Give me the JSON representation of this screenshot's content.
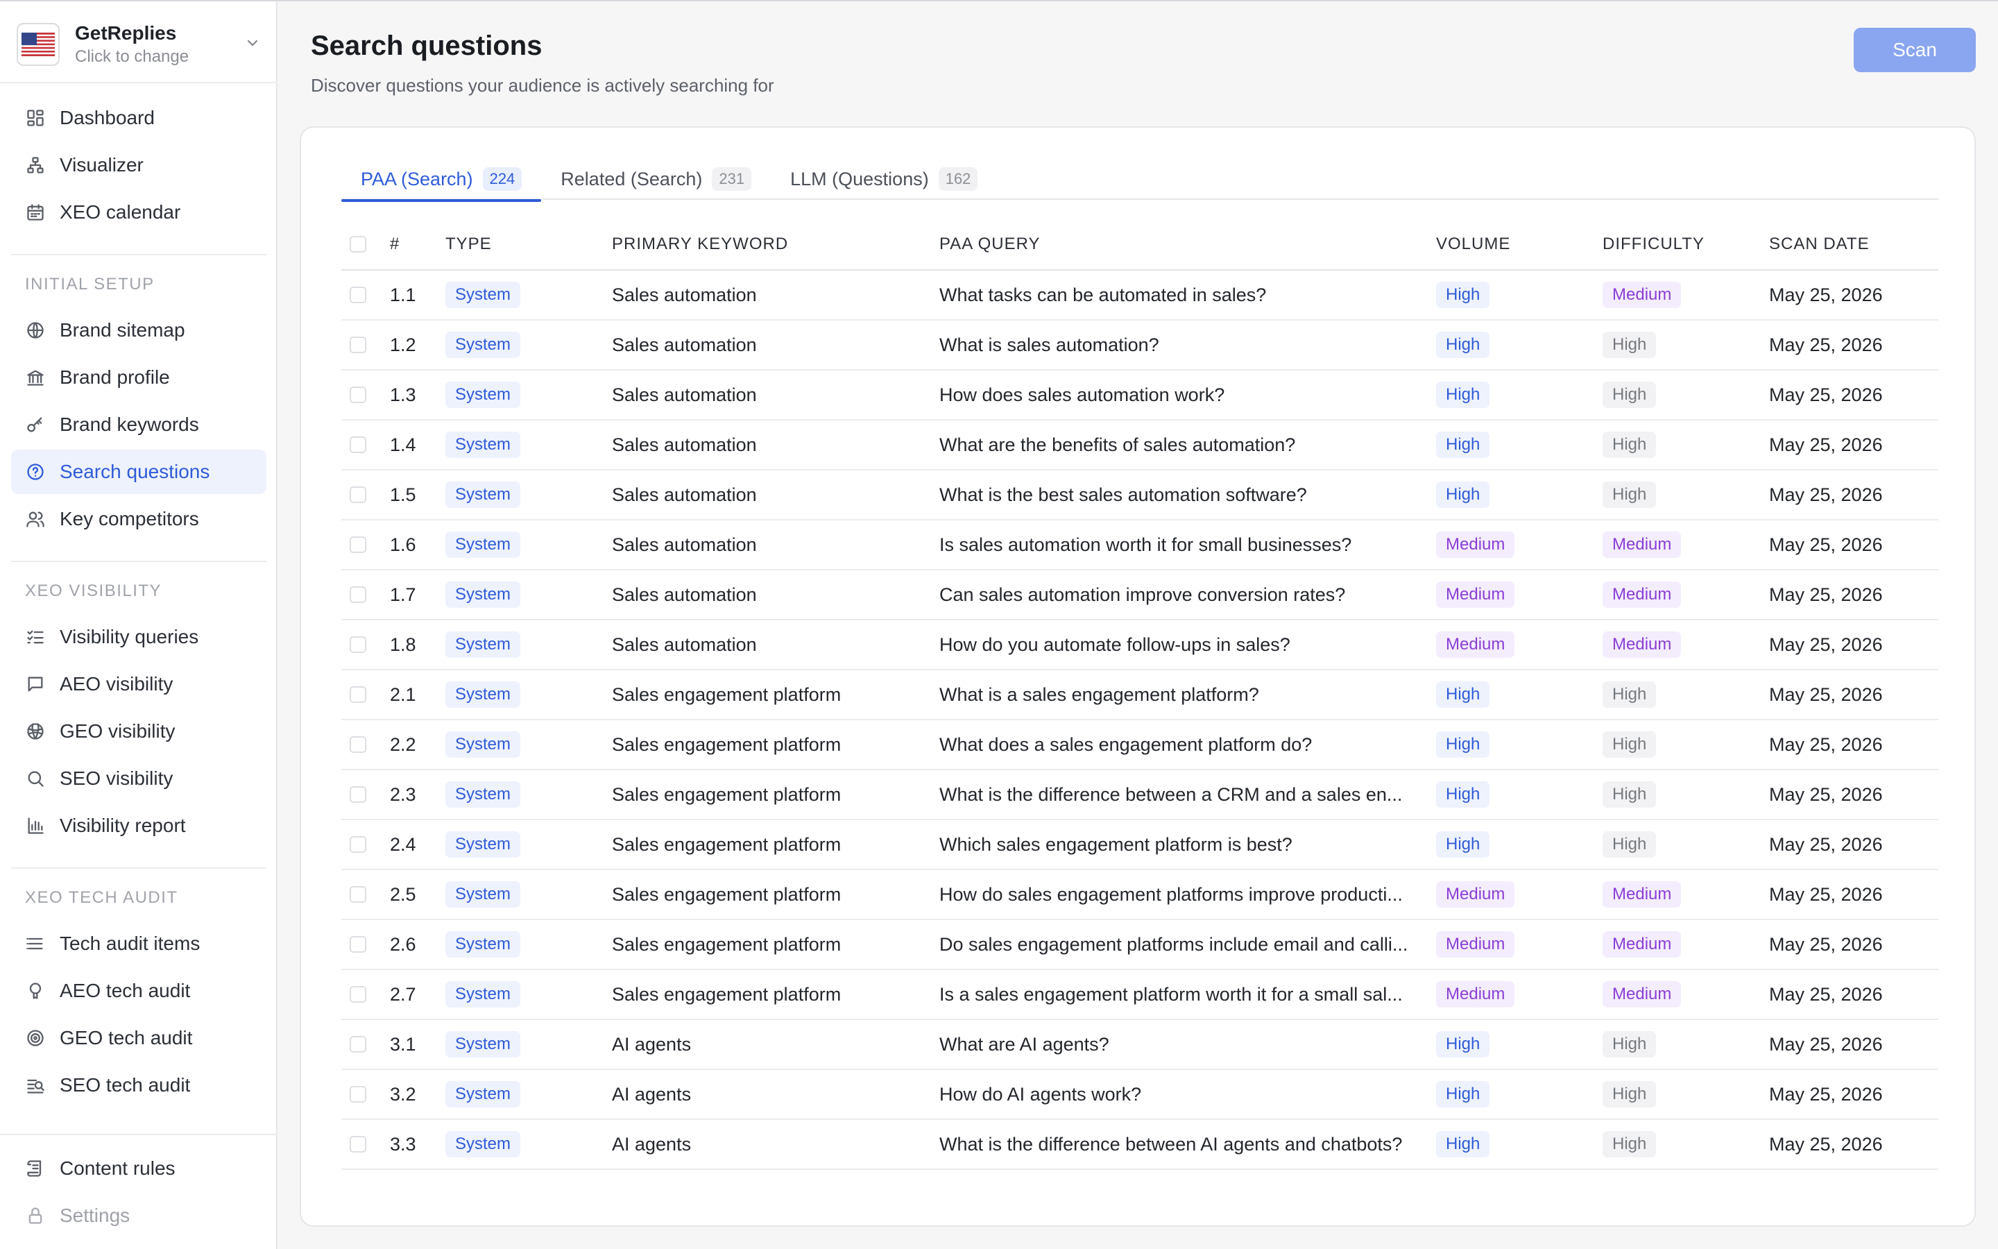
{
  "brand": {
    "name": "GetReplies",
    "subtitle": "Click to change"
  },
  "sidebar": {
    "main_items": [
      {
        "label": "Dashboard",
        "icon": "dashboard-icon"
      },
      {
        "label": "Visualizer",
        "icon": "sitemap-icon"
      },
      {
        "label": "XEO calendar",
        "icon": "calendar-icon"
      }
    ],
    "sections": [
      {
        "title": "INITIAL SETUP",
        "items": [
          {
            "label": "Brand sitemap",
            "icon": "globe-icon"
          },
          {
            "label": "Brand profile",
            "icon": "bank-icon"
          },
          {
            "label": "Brand keywords",
            "icon": "key-icon"
          },
          {
            "label": "Search questions",
            "icon": "question-circle-icon",
            "active": true
          },
          {
            "label": "Key competitors",
            "icon": "users-icon"
          }
        ]
      },
      {
        "title": "XEO VISIBILITY",
        "items": [
          {
            "label": "Visibility queries",
            "icon": "list-check-icon"
          },
          {
            "label": "AEO visibility",
            "icon": "chat-icon"
          },
          {
            "label": "GEO visibility",
            "icon": "globe-grid-icon"
          },
          {
            "label": "SEO visibility",
            "icon": "search-icon"
          },
          {
            "label": "Visibility report",
            "icon": "bar-chart-icon"
          }
        ]
      },
      {
        "title": "XEO TECH AUDIT",
        "items": [
          {
            "label": "Tech audit items",
            "icon": "list-icon"
          },
          {
            "label": "AEO tech audit",
            "icon": "bulb-icon"
          },
          {
            "label": "GEO tech audit",
            "icon": "target-icon"
          },
          {
            "label": "SEO tech audit",
            "icon": "search-list-icon"
          }
        ]
      }
    ],
    "bottom_items": [
      {
        "label": "Content rules",
        "icon": "scroll-icon"
      },
      {
        "label": "Settings",
        "icon": "lock-icon",
        "disabled": true
      }
    ]
  },
  "header": {
    "title": "Search questions",
    "subtitle": "Discover questions your audience is actively searching for",
    "scan_label": "Scan"
  },
  "tabs": [
    {
      "label": "PAA (Search)",
      "count": "224",
      "active": true
    },
    {
      "label": "Related (Search)",
      "count": "231"
    },
    {
      "label": "LLM (Questions)",
      "count": "162"
    }
  ],
  "table": {
    "columns": [
      "#",
      "TYPE",
      "PRIMARY KEYWORD",
      "PAA QUERY",
      "VOLUME",
      "DIFFICULTY",
      "SCAN DATE"
    ],
    "rows": [
      {
        "num": "1.1",
        "type": "System",
        "keyword": "Sales automation",
        "query": "What tasks can be automated in sales?",
        "volume": "High",
        "difficulty": "Medium",
        "date": "May 25, 2026"
      },
      {
        "num": "1.2",
        "type": "System",
        "keyword": "Sales automation",
        "query": "What is sales automation?",
        "volume": "High",
        "difficulty": "High",
        "date": "May 25, 2026"
      },
      {
        "num": "1.3",
        "type": "System",
        "keyword": "Sales automation",
        "query": "How does sales automation work?",
        "volume": "High",
        "difficulty": "High",
        "date": "May 25, 2026"
      },
      {
        "num": "1.4",
        "type": "System",
        "keyword": "Sales automation",
        "query": "What are the benefits of sales automation?",
        "volume": "High",
        "difficulty": "High",
        "date": "May 25, 2026"
      },
      {
        "num": "1.5",
        "type": "System",
        "keyword": "Sales automation",
        "query": "What is the best sales automation software?",
        "volume": "High",
        "difficulty": "High",
        "date": "May 25, 2026"
      },
      {
        "num": "1.6",
        "type": "System",
        "keyword": "Sales automation",
        "query": "Is sales automation worth it for small businesses?",
        "volume": "Medium",
        "difficulty": "Medium",
        "date": "May 25, 2026"
      },
      {
        "num": "1.7",
        "type": "System",
        "keyword": "Sales automation",
        "query": "Can sales automation improve conversion rates?",
        "volume": "Medium",
        "difficulty": "Medium",
        "date": "May 25, 2026"
      },
      {
        "num": "1.8",
        "type": "System",
        "keyword": "Sales automation",
        "query": "How do you automate follow-ups in sales?",
        "volume": "Medium",
        "difficulty": "Medium",
        "date": "May 25, 2026"
      },
      {
        "num": "2.1",
        "type": "System",
        "keyword": "Sales engagement platform",
        "query": "What is a sales engagement platform?",
        "volume": "High",
        "difficulty": "High",
        "date": "May 25, 2026"
      },
      {
        "num": "2.2",
        "type": "System",
        "keyword": "Sales engagement platform",
        "query": "What does a sales engagement platform do?",
        "volume": "High",
        "difficulty": "High",
        "date": "May 25, 2026"
      },
      {
        "num": "2.3",
        "type": "System",
        "keyword": "Sales engagement platform",
        "query": "What is the difference between a CRM and a sales en...",
        "volume": "High",
        "difficulty": "High",
        "date": "May 25, 2026"
      },
      {
        "num": "2.4",
        "type": "System",
        "keyword": "Sales engagement platform",
        "query": "Which sales engagement platform is best?",
        "volume": "High",
        "difficulty": "High",
        "date": "May 25, 2026"
      },
      {
        "num": "2.5",
        "type": "System",
        "keyword": "Sales engagement platform",
        "query": "How do sales engagement platforms improve producti...",
        "volume": "Medium",
        "difficulty": "Medium",
        "date": "May 25, 2026"
      },
      {
        "num": "2.6",
        "type": "System",
        "keyword": "Sales engagement platform",
        "query": "Do sales engagement platforms include email and calli...",
        "volume": "Medium",
        "difficulty": "Medium",
        "date": "May 25, 2026"
      },
      {
        "num": "2.7",
        "type": "System",
        "keyword": "Sales engagement platform",
        "query": "Is a sales engagement platform worth it for a small sal...",
        "volume": "Medium",
        "difficulty": "Medium",
        "date": "May 25, 2026"
      },
      {
        "num": "3.1",
        "type": "System",
        "keyword": "AI agents",
        "query": "What are AI agents?",
        "volume": "High",
        "difficulty": "High",
        "date": "May 25, 2026"
      },
      {
        "num": "3.2",
        "type": "System",
        "keyword": "AI agents",
        "query": "How do AI agents work?",
        "volume": "High",
        "difficulty": "High",
        "date": "May 25, 2026"
      },
      {
        "num": "3.3",
        "type": "System",
        "keyword": "AI agents",
        "query": "What is the difference between AI agents and chatbots?",
        "volume": "High",
        "difficulty": "High",
        "date": "May 25, 2026"
      }
    ]
  },
  "colors": {
    "accent": "#2f5bd8",
    "scan_button": "#8aa6f0",
    "medium_badge": "#8a3fd6",
    "active_bg": "#eef2fd"
  }
}
